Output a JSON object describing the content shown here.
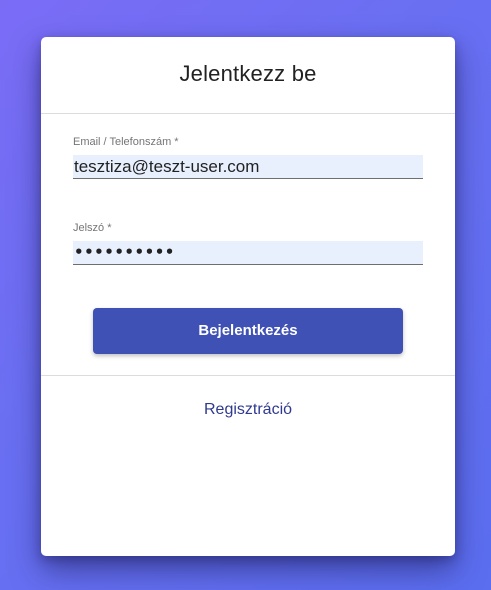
{
  "form": {
    "title": "Jelentkezz be",
    "email": {
      "label": "Email / Telefonszám *",
      "value": "tesztiza@teszt-user.com"
    },
    "password": {
      "label": "Jelszó *",
      "masked_value": "••••••••••"
    },
    "login_button_label": "Bejelentkezés",
    "register_link_label": "Regisztráció"
  },
  "colors": {
    "primary": "#3f51b5",
    "link": "#2f3a8f",
    "autofill_background": "#e8f0fe",
    "background_gradient_start": "#7b6cf6",
    "background_gradient_end": "#5b6ef0"
  }
}
